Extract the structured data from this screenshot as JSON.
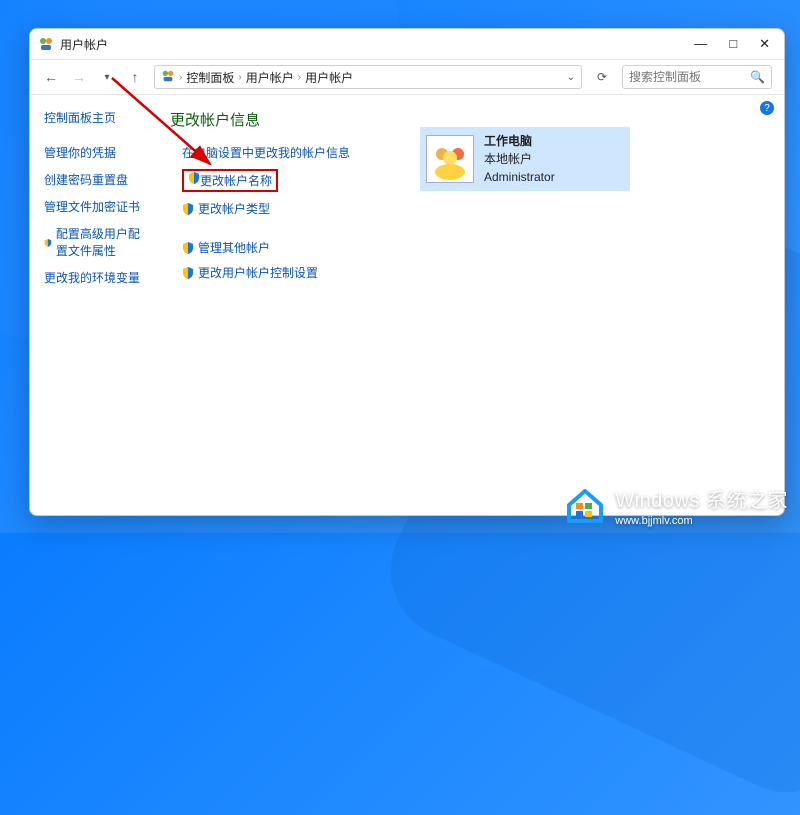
{
  "window": {
    "title": "用户帐户"
  },
  "toolbar": {
    "breadcrumb": [
      "控制面板",
      "用户帐户",
      "用户帐户"
    ],
    "search_placeholder": "搜索控制面板"
  },
  "sidebar": {
    "home": "控制面板主页",
    "items": [
      "管理你的凭据",
      "创建密码重置盘",
      "管理文件加密证书",
      "配置高级用户配置文件属性",
      "更改我的环境变量"
    ]
  },
  "content": {
    "heading": "更改帐户信息",
    "primary": [
      "在电脑设置中更改我的帐户信息",
      "更改帐户名称",
      "更改帐户类型"
    ],
    "secondary": [
      "管理其他帐户",
      "更改用户帐户控制设置"
    ],
    "highlighted_index": 1
  },
  "user": {
    "name": "工作电脑",
    "type": "本地帐户",
    "role": "Administrator"
  },
  "watermark": {
    "title": "Windows 系统之家",
    "url": "www.bjjmlv.com"
  }
}
